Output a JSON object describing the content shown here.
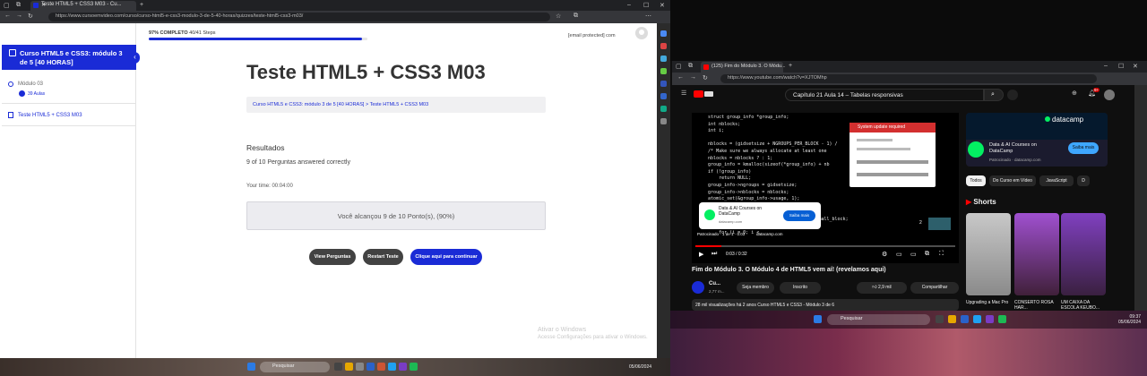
{
  "left_browser": {
    "tab_title": "Teste HTML5 + CSS3 M03 - Cu...",
    "url": "https://www.cursoemvideo.com/curso/curso-html5-e-css3-modulo-3-de-5-40-horas/quizzes/teste-html5-css3-m03/",
    "new_tab": "+",
    "win_minimize": "–",
    "win_maximize": "☐",
    "win_close": "✕"
  },
  "lms": {
    "progress_label": "97% COMPLETO",
    "progress_steps": "40/41 Steps",
    "progress_fraction": 0.976,
    "user_email": "[email protected] com",
    "sidebar": {
      "course_title": "Curso HTML5 e CSS3: módulo 3 de 5 [40 HORAS]",
      "module": "Módulo 03",
      "lessons": "39 Aulas",
      "quiz_item": "Teste HTML5 + CSS3 M03"
    },
    "page_title": "Teste HTML5 + CSS3 M03",
    "breadcrumb": "Curso HTML5 e CSS3: módulo 3 de 5 [40 HORAS] > Teste HTML5 + CSS3 M03",
    "results_heading": "Resultados",
    "results_summary": "9 of 10 Perguntas answered correctly",
    "time_label": "Your time: 00:04:00",
    "score_text": "Você alcançou 9 de 10 Ponto(s), (90%)",
    "buttons": {
      "view_questions": "View Perguntas",
      "restart": "Restart Teste",
      "continue": "Clique aqui para continuar"
    },
    "colors": {
      "accent": "#1a2bd6",
      "neutral_button": "#424242"
    }
  },
  "left_taskbar": {
    "search": "Pesquisar",
    "clock": "05/06/2024",
    "watermark_title": "Ativar o Windows",
    "watermark_sub": "Acesse Configurações para ativar o Windows."
  },
  "right_browser": {
    "tab_title": "(125) Fim do Módulo 3. O Módu...",
    "url": "https://www.youtube.com/watch?v=XJTOMhp"
  },
  "youtube": {
    "search_query": "Capítulo 21 Aula 14 – Tabelas responsivas",
    "notif_count": "9+",
    "video": {
      "code_lines": [
        "    struct group_info *group_info;",
        "    int nblocks;",
        "    int i;",
        "",
        "    nblocks = (gidsetsize + NGROUPS_PER_BLOCK - 1) /",
        "    /* Make sure we always allocate at least one",
        "    nblocks = nblocks ? : 1;",
        "    group_info = kmalloc(sizeof(*group_info) + nb",
        "    if (!group_info)",
        "        return NULL;",
        "    group_info->ngroups = gidsetsize;",
        "    group_info->nblocks = nblocks;",
        "    atomic_set(&group_info->usage, 1);",
        "",
        "    if (gidsetsize <= NGROUPS_SMALL)",
        "        group_info->blocks[0] = group_info->small_block;",
        "    else {",
        "        for (i = 0; i < "
      ],
      "popup_title": "System update required",
      "ad_title": "Data & AI Courses on DataCamp",
      "ad_url": "datacamp.com",
      "ad_button": "Saiba mais",
      "ad_count": "2",
      "sponsor_line": "Patrocinado · 1 de 1 · 0:03",
      "sponsor_site": "datacamp.com",
      "time": "0:03 / 0:32",
      "progress_fraction": 0.1
    },
    "title": "Fim do Módulo 3. O Módulo 4 de HTML5 vem aí! (revelamos aqui)",
    "channel_name": "Cu...",
    "channel_subs": "2,77 m...",
    "member_btn": "Seja membro",
    "subscribed_btn": "Inscrito",
    "likes": "2,9 mil",
    "share_btn": "Compartilhar",
    "description": "28 mil visualizações  há 2 anos  Curso HTML5 e CSS3 - Módulo 3 de 6",
    "side_ad": {
      "brand": "datacamp",
      "title": "Data & AI Courses on DataCamp",
      "sponsor": "Patrocinado · datacamp.com",
      "button": "Saiba mais"
    },
    "chips": [
      "Todos",
      "Do Curso em Vídeo",
      "JavaScript",
      "D"
    ],
    "shorts_heading": "Shorts",
    "shorts": [
      {
        "caption": "Upgrading a Mac Pro"
      },
      {
        "caption": "CONSERTO ROSA HAR..."
      },
      {
        "caption": "UM CAIXA DA ESCOLA KEUBO..."
      }
    ]
  },
  "right_taskbar": {
    "search": "Pesquisar",
    "time": "09:37",
    "date": "05/06/2024"
  }
}
